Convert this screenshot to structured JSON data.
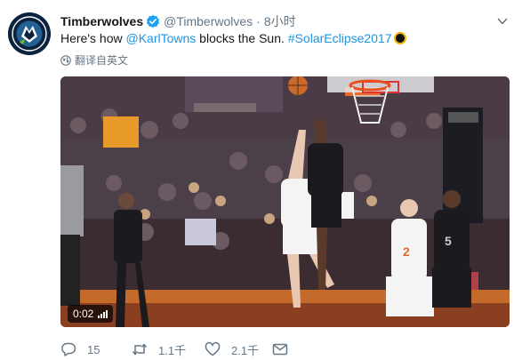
{
  "tweet": {
    "display_name": "Timberwolves",
    "handle": "@Timberwolves",
    "separator": "·",
    "time": "8小时",
    "text_before": "Here's how ",
    "mention": "@KarlTowns",
    "text_middle": " blocks the Sun. ",
    "hashtag": "#SolarEclipse2017",
    "translate_label": "翻译自英文"
  },
  "media": {
    "duration": "0:02",
    "jersey_numbers": [
      "2",
      "5"
    ]
  },
  "actions": {
    "reply_count": "15",
    "retweet_count": "1.1千",
    "like_count": "2.1千"
  },
  "colors": {
    "link": "#1b95e0",
    "muted": "#657786",
    "verified": "#1da1f2",
    "team_navy": "#0c2340"
  },
  "icons": [
    "wolf-logo-icon",
    "verified-badge-icon",
    "chevron-down-icon",
    "sun-emoji-icon",
    "globe-icon",
    "reply-icon",
    "retweet-icon",
    "like-icon",
    "message-icon",
    "volume-icon"
  ]
}
